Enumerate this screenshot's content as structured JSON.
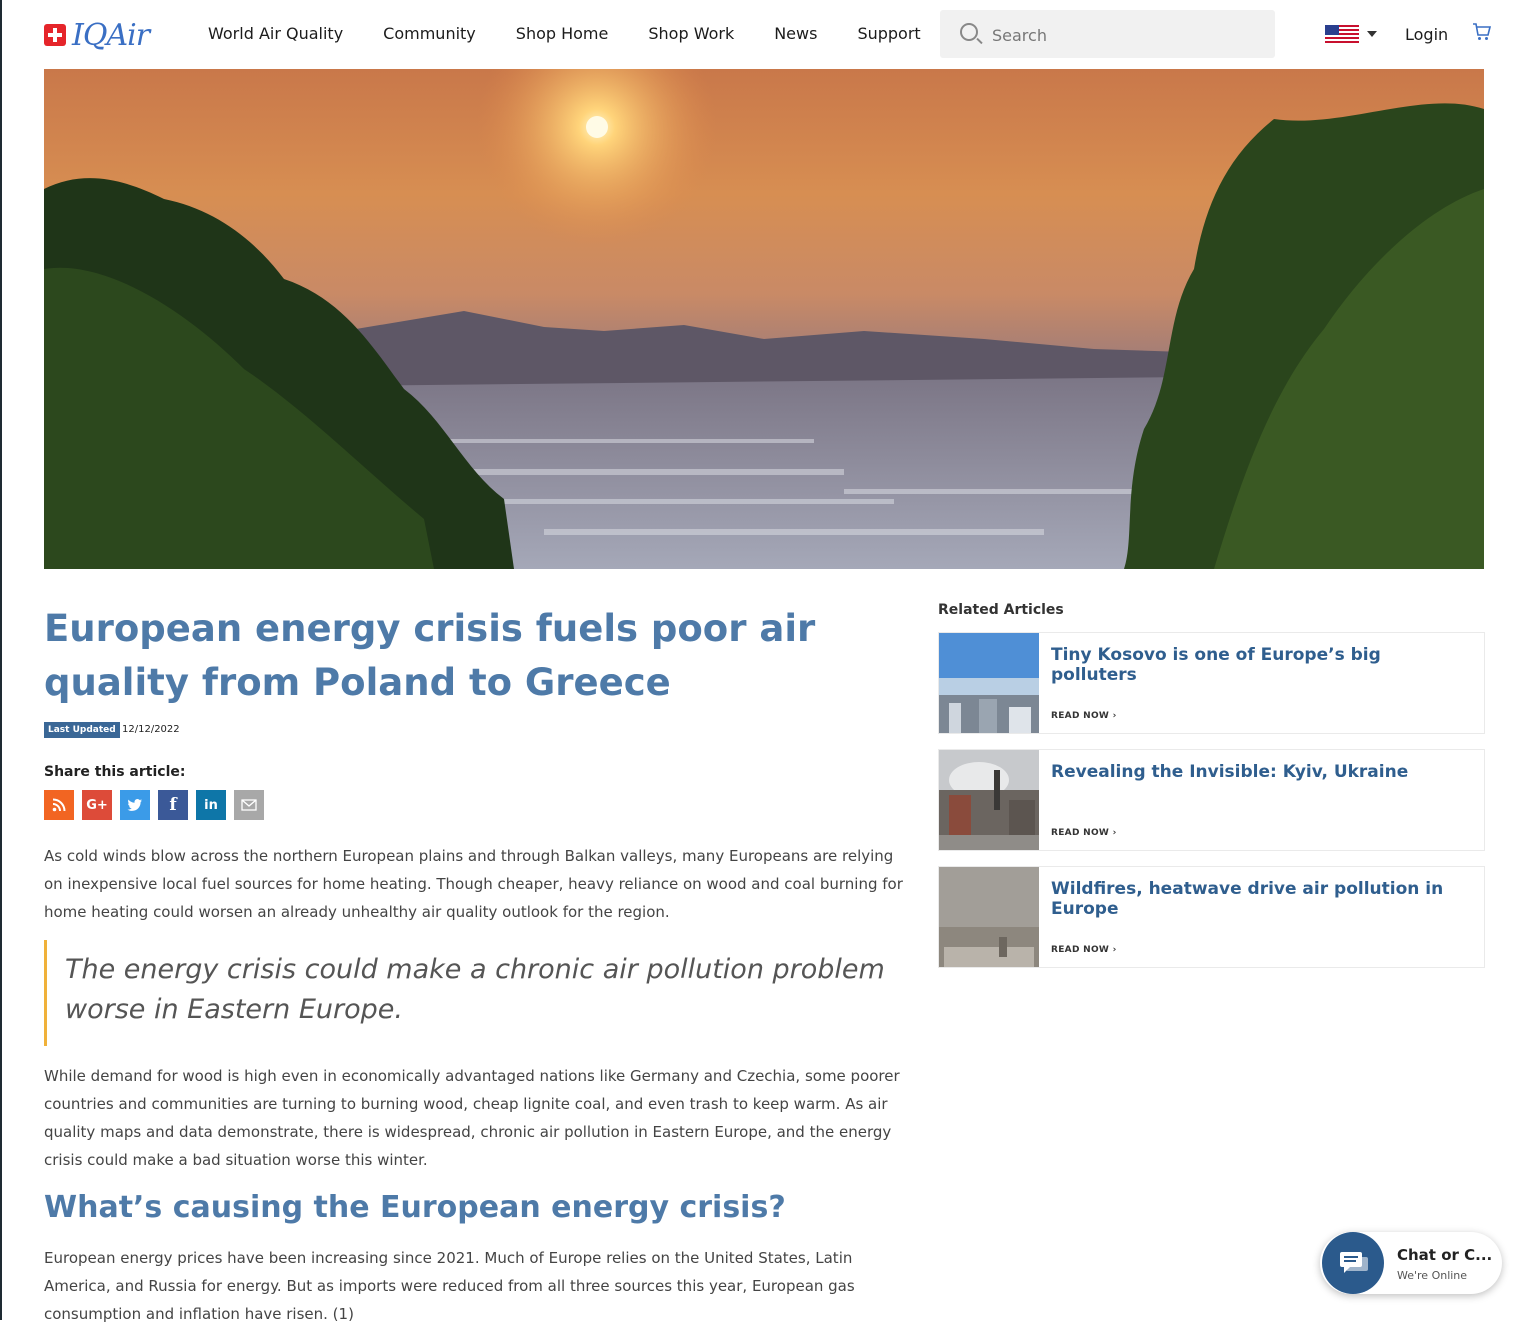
{
  "header": {
    "logo_text": "IQAir",
    "nav": [
      "World Air Quality",
      "Community",
      "Shop Home",
      "Shop Work",
      "News",
      "Support"
    ],
    "search_placeholder": "Search",
    "login": "Login"
  },
  "article": {
    "title": "European energy crisis fuels poor air quality from Poland to Greece",
    "updated_label": "Last Updated",
    "updated_date": "12/12/2022",
    "share_label": "Share this article:",
    "share_icons": [
      "rss-icon",
      "google-plus-icon",
      "twitter-icon",
      "facebook-icon",
      "linkedin-icon",
      "email-icon"
    ],
    "paragraph1": "As cold winds blow across the northern European plains and through Balkan valleys, many Europeans are relying on inexpensive local fuel sources for home heating. Though cheaper, heavy reliance on wood and coal burning for home heating could worsen an already unhealthy air quality outlook for the region.",
    "quote": "The energy crisis could make a chronic air pollution problem worse in Eastern Europe.",
    "paragraph2": "While demand for wood is high even in economically advantaged nations like Germany and Czechia, some poorer countries and communities are turning to burning wood, cheap lignite coal, and even trash to keep warm. As air quality maps and data demonstrate, there is widespread, chronic air pollution in Eastern Europe, and the energy crisis could make a bad situation worse this winter.",
    "heading2": "What’s causing the European energy crisis?",
    "paragraph3": "European energy prices have been increasing since 2021. Much of Europe relies on the United States, Latin America, and Russia for energy. But as imports were reduced from all three sources this year, European gas consumption and inflation have risen. (1)"
  },
  "related": {
    "title": "Related Articles",
    "items": [
      {
        "title": "Tiny Kosovo is one of Europe’s big polluters",
        "cta": "READ NOW"
      },
      {
        "title": "Revealing the Invisible: Kyiv, Ukraine",
        "cta": "READ NOW"
      },
      {
        "title": "Wildfires, heatwave drive air pollution in Europe",
        "cta": "READ NOW"
      }
    ]
  },
  "chat": {
    "title": "Chat or C...",
    "status": "We're Online"
  },
  "colors": {
    "brand_blue": "#4e7aa8",
    "link_blue": "#2f5e8e",
    "quote_accent": "#f0b13a",
    "badge": "#3a6796"
  }
}
